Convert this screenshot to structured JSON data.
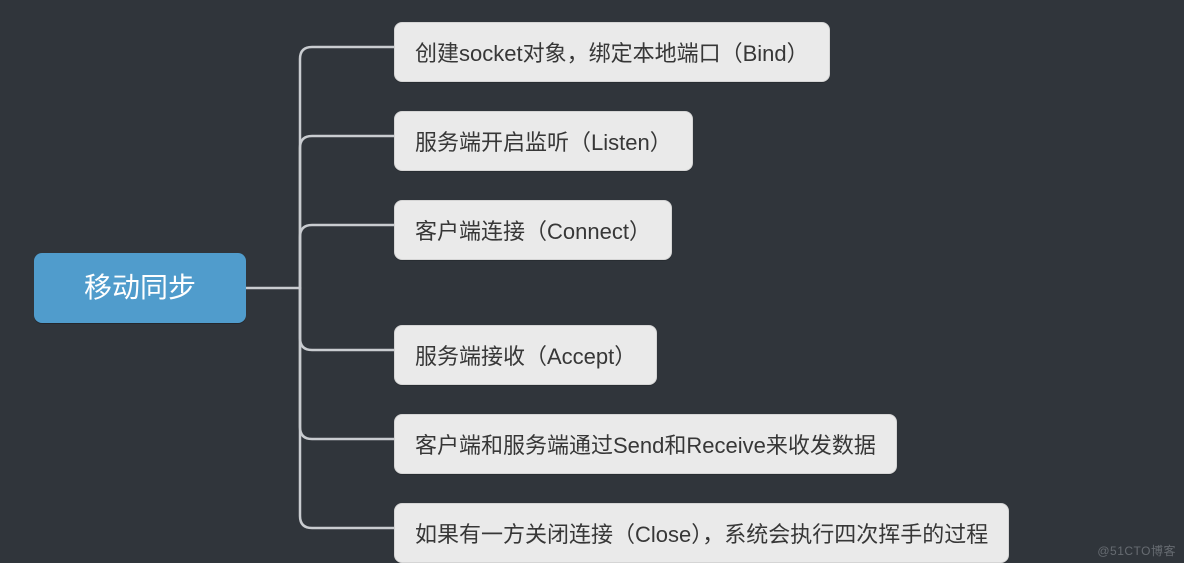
{
  "diagram": {
    "root": "移动同步",
    "children": [
      "创建socket对象，绑定本地端口（Bind）",
      "服务端开启监听（Listen）",
      "客户端连接（Connect）",
      "服务端接收（Accept）",
      "客户端和服务端通过Send和Receive来收发数据",
      "如果有一方关闭连接（Close），系统会执行四次挥手的过程"
    ]
  },
  "colors": {
    "background": "#30353b",
    "rootFill": "#509ccc",
    "rootText": "#ffffff",
    "childFill": "#eaeaea",
    "childText": "#373737",
    "connector": "#c9ccd0"
  },
  "watermark": "@51CTO博客"
}
